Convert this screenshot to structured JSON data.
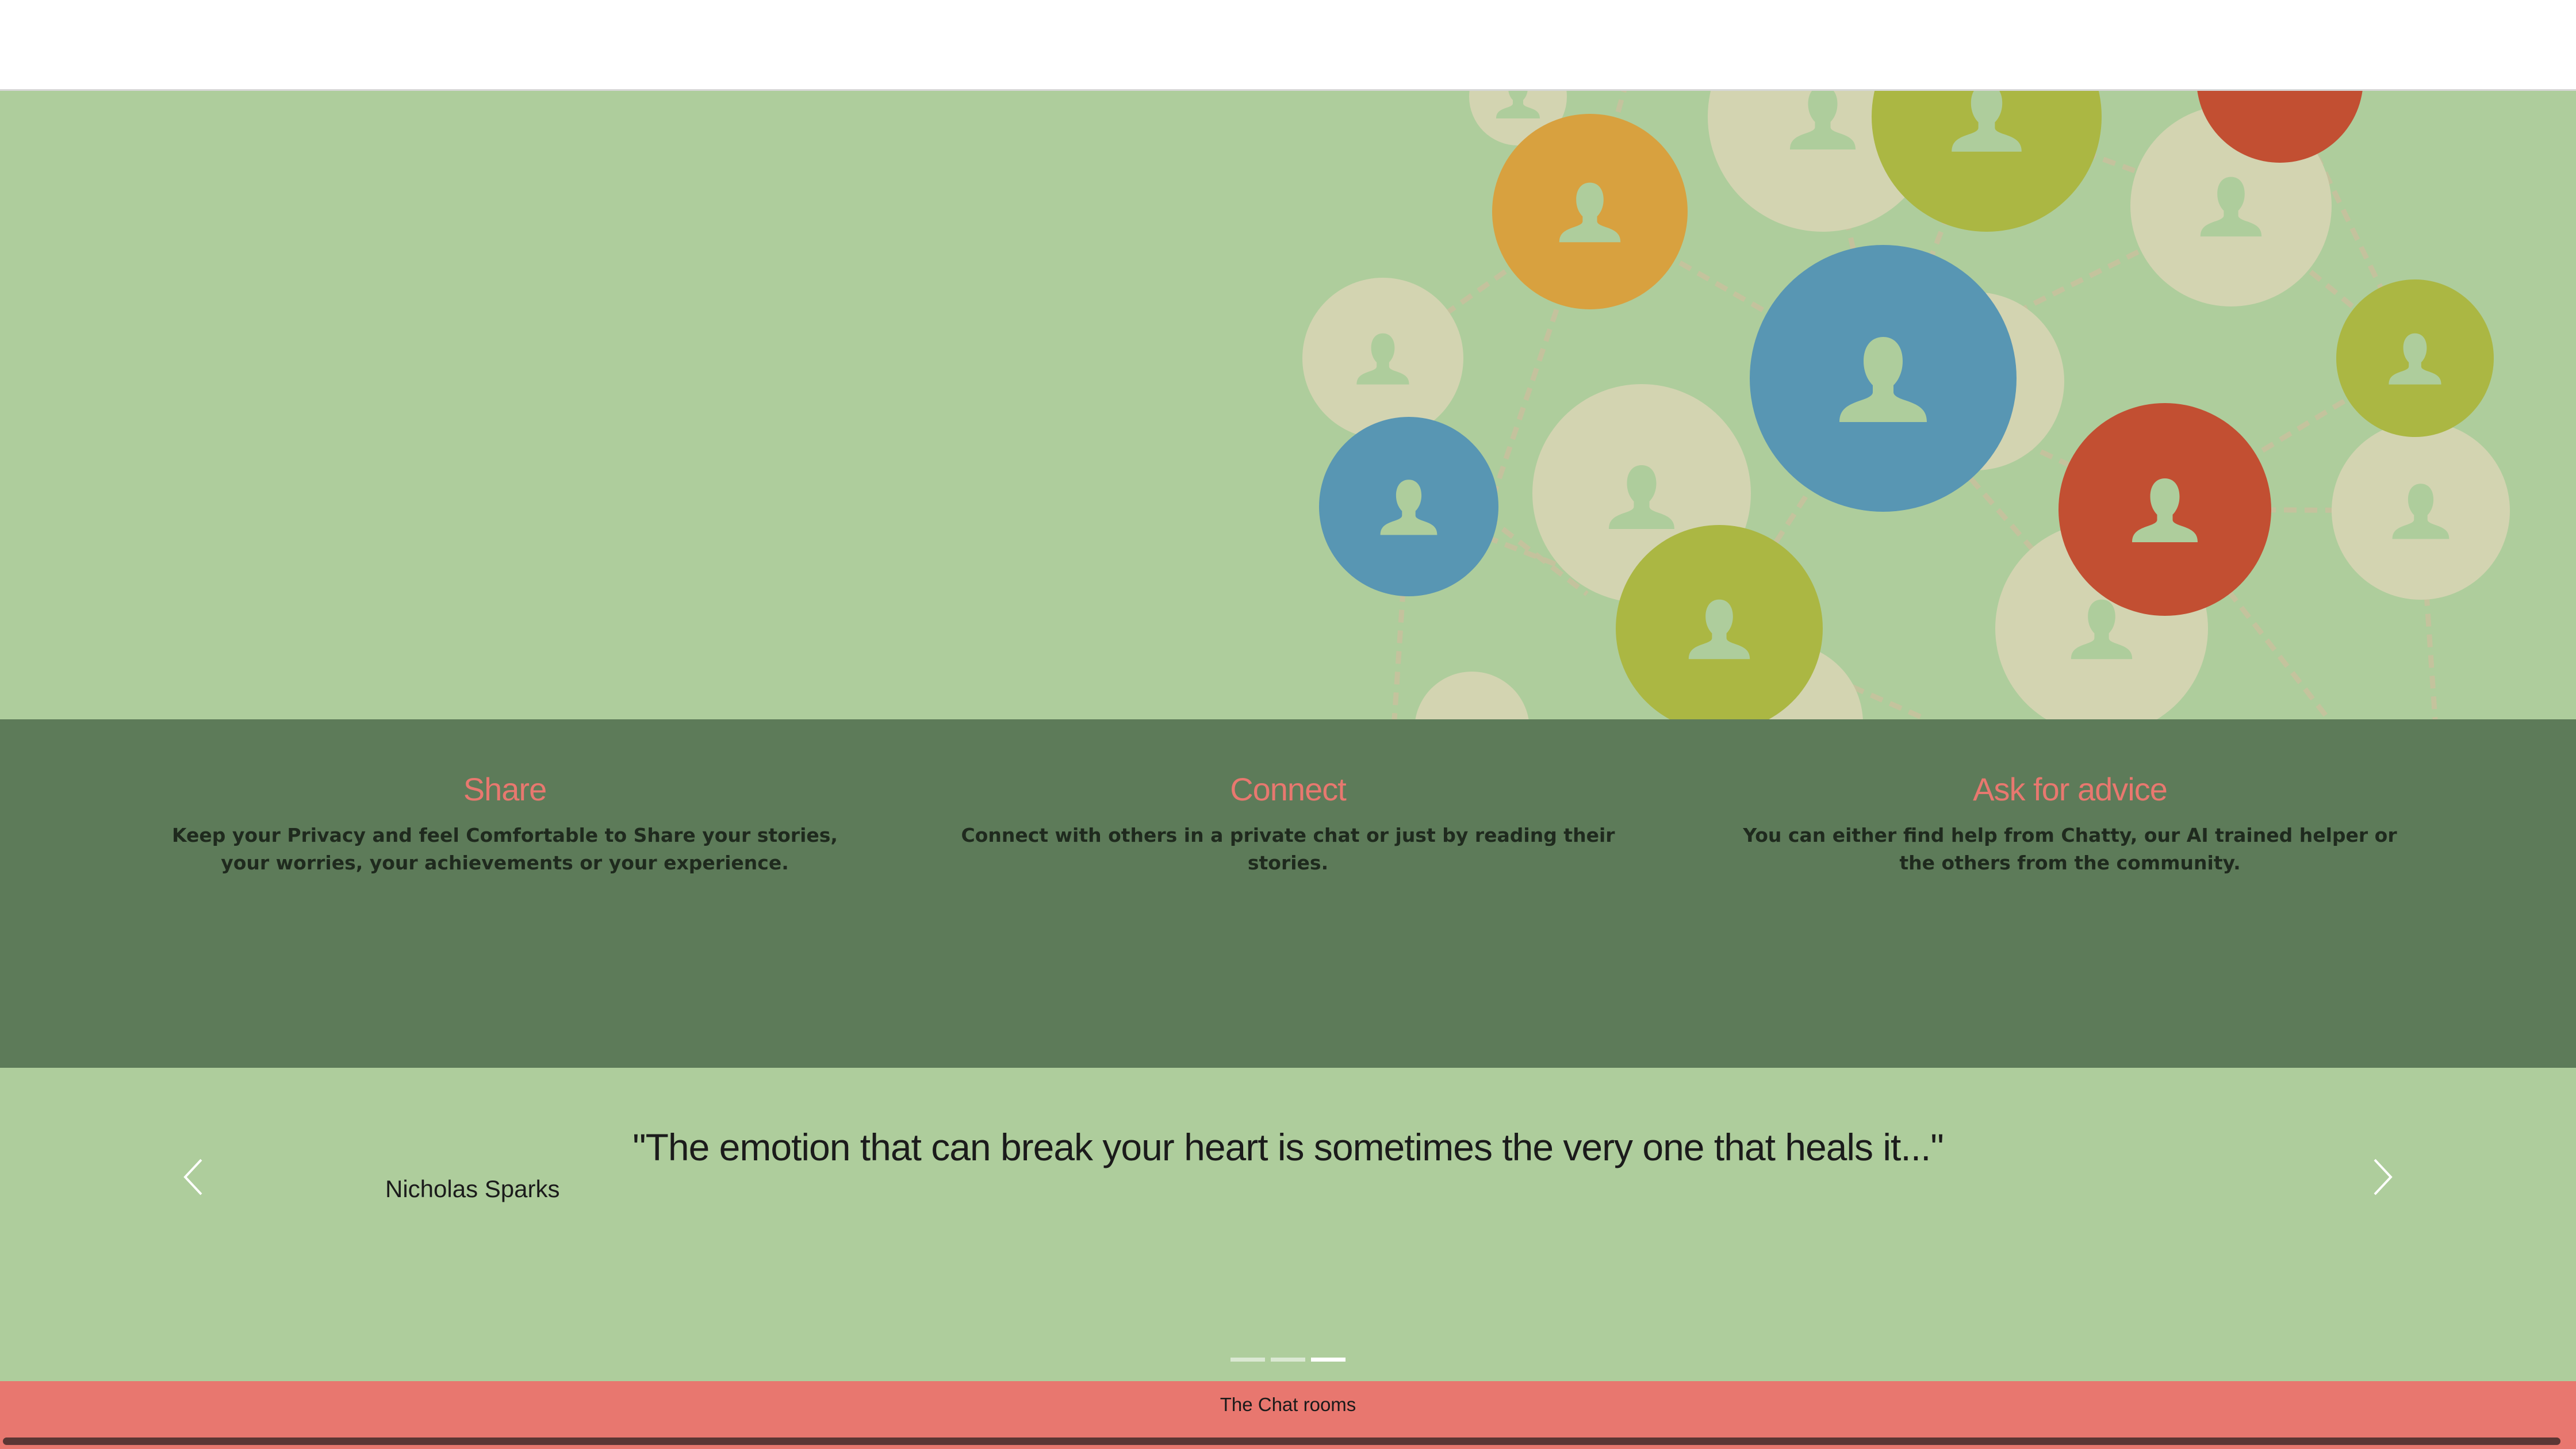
{
  "features": [
    {
      "title": "Share",
      "text": "Keep your Privacy and feel Comfortable to Share your stories, your worries, your achievements or your experience."
    },
    {
      "title": "Connect",
      "text": "Connect with others in a private chat or just by reading their stories."
    },
    {
      "title": "Ask for advice",
      "text": "You can either find help from Chatty, our AI trained helper or the others from the community."
    }
  ],
  "carousel": {
    "quote": "\"The emotion that can break your heart is sometimes the very one that heals it...\"",
    "author": "Nicholas Sparks",
    "slide_count": 3,
    "active_slide": 3,
    "prev_icon": "chevron-left-icon",
    "next_icon": "chevron-right-icon"
  },
  "footer": {
    "label": "The Chat rooms"
  },
  "colors": {
    "page_bg": "#aecd9c",
    "features_bg": "#5d7b59",
    "accent": "#e8786f",
    "footer_bg": "#e8776f",
    "node_beige": "#d3d4b1",
    "node_orange": "#d8a13f",
    "node_olive": "#abb743",
    "node_blue": "#5896b3",
    "node_red": "#c24f32"
  },
  "hero_icon": "people-network-illustration"
}
